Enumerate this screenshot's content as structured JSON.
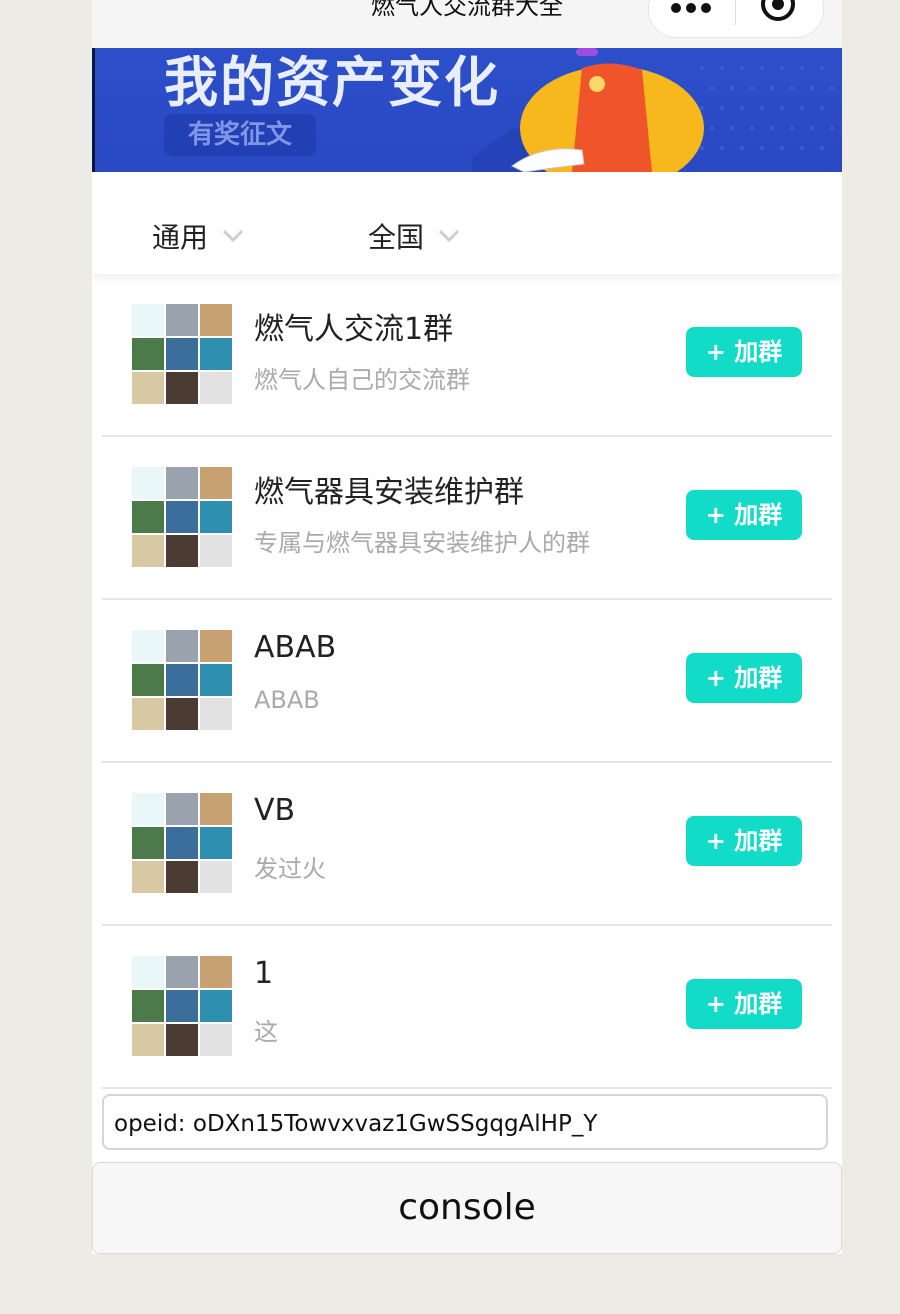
{
  "nav": {
    "title": "燃气人交流群大全"
  },
  "banner": {
    "title": "我的资产变化",
    "tag": "有奖征文"
  },
  "filters": [
    {
      "label": "通用"
    },
    {
      "label": "全国"
    }
  ],
  "groups": [
    {
      "name": "燃气人交流1群",
      "desc": "燃气人自己的交流群",
      "button": "+ 加群"
    },
    {
      "name": "燃气器具安装维护群",
      "desc": "专属与燃气器具安装维护人的群",
      "button": "+ 加群"
    },
    {
      "name": "ABAB",
      "desc": "ABAB",
      "button": "+ 加群"
    },
    {
      "name": "VB",
      "desc": "发过火",
      "button": "+ 加群"
    },
    {
      "name": "1",
      "desc": "这",
      "button": "+ 加群"
    }
  ],
  "openid_text": "opeid: oDXn15Towvxvaz1GwSSgqgAlHP_Y",
  "console_label": "console",
  "colors": {
    "accent": "#12dcc8",
    "banner_blue": "#2c4fc9"
  },
  "icons": [
    "more-icon",
    "close-target-icon",
    "chevron-down-icon"
  ]
}
